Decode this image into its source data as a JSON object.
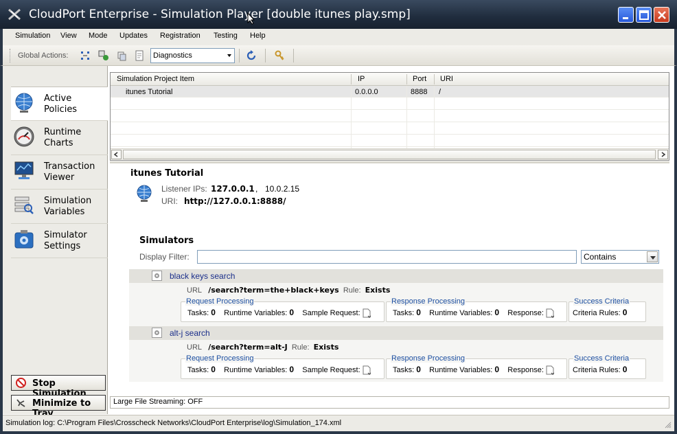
{
  "window": {
    "title": "CloudPort Enterprise - Simulation Player [double itunes play.smp]"
  },
  "menu": [
    "Simulation",
    "View",
    "Mode",
    "Updates",
    "Registration",
    "Testing",
    "Help"
  ],
  "toolbar": {
    "label": "Global Actions:",
    "dropdown_value": "Diagnostics"
  },
  "nav": {
    "items": [
      {
        "line1": "Active",
        "line2": "Policies",
        "icon": "globe-icon",
        "active": true
      },
      {
        "line1": "Runtime",
        "line2": "Charts",
        "icon": "gauge-icon",
        "active": false
      },
      {
        "line1": "Transaction",
        "line2": "Viewer",
        "icon": "monitor-icon",
        "active": false
      },
      {
        "line1": "Simulation",
        "line2": "Variables",
        "icon": "variables-icon",
        "active": false
      },
      {
        "line1": "Simulator",
        "line2": "Settings",
        "icon": "settings-icon",
        "active": false
      }
    ],
    "stop_button": "Stop Simulation",
    "tray_button": "Minimize to Tray"
  },
  "grid": {
    "columns": [
      "Simulation Project Item",
      "IP",
      "Port",
      "URI"
    ],
    "rows": [
      {
        "item": "itunes Tutorial",
        "ip": "0.0.0.0",
        "port": "8888",
        "uri": "/"
      }
    ]
  },
  "detail": {
    "title": "itunes Tutorial",
    "listener_label": "Listener IPs:",
    "listener_ip1": "127.0.0.1",
    "listener_sep": ",",
    "listener_ip2": "10.0.2.15",
    "uri_label": "URI:",
    "uri_value": "http://127.0.0.1:8888/",
    "simulators_title": "Simulators",
    "filter_label": "Display Filter:",
    "filter_value": "",
    "filter_mode": "Contains",
    "simulators": [
      {
        "name": "black keys search",
        "url_label": "URL",
        "url": "/search?term=the+black+keys",
        "rule_label": "Rule:",
        "rule": "Exists",
        "req_title": "Request Processing",
        "req_tasks_label": "Tasks:",
        "req_tasks": "0",
        "req_vars_label": "Runtime Variables:",
        "req_vars": "0",
        "req_sample_label": "Sample Request:",
        "resp_title": "Response Processing",
        "resp_tasks_label": "Tasks:",
        "resp_tasks": "0",
        "resp_vars_label": "Runtime Variables:",
        "resp_vars": "0",
        "resp_label": "Response:",
        "crit_title": "Success Criteria",
        "crit_label": "Criteria Rules:",
        "crit_rules": "0"
      },
      {
        "name": "alt-j search",
        "url_label": "URL",
        "url": "/search?term=alt-J",
        "rule_label": "Rule:",
        "rule": "Exists",
        "req_title": "Request Processing",
        "req_tasks_label": "Tasks:",
        "req_tasks": "0",
        "req_vars_label": "Runtime Variables:",
        "req_vars": "0",
        "req_sample_label": "Sample Request:",
        "resp_title": "Response Processing",
        "resp_tasks_label": "Tasks:",
        "resp_tasks": "0",
        "resp_vars_label": "Runtime Variables:",
        "resp_vars": "0",
        "resp_label": "Response:",
        "crit_title": "Success Criteria",
        "crit_label": "Criteria Rules:",
        "crit_rules": "0"
      }
    ]
  },
  "status": {
    "file_streaming": "Large File Streaming: OFF",
    "log": "Simulation log: C:\\Program Files\\Crosscheck Networks\\CloudPort Enterprise\\log\\Simulation_174.xml"
  }
}
